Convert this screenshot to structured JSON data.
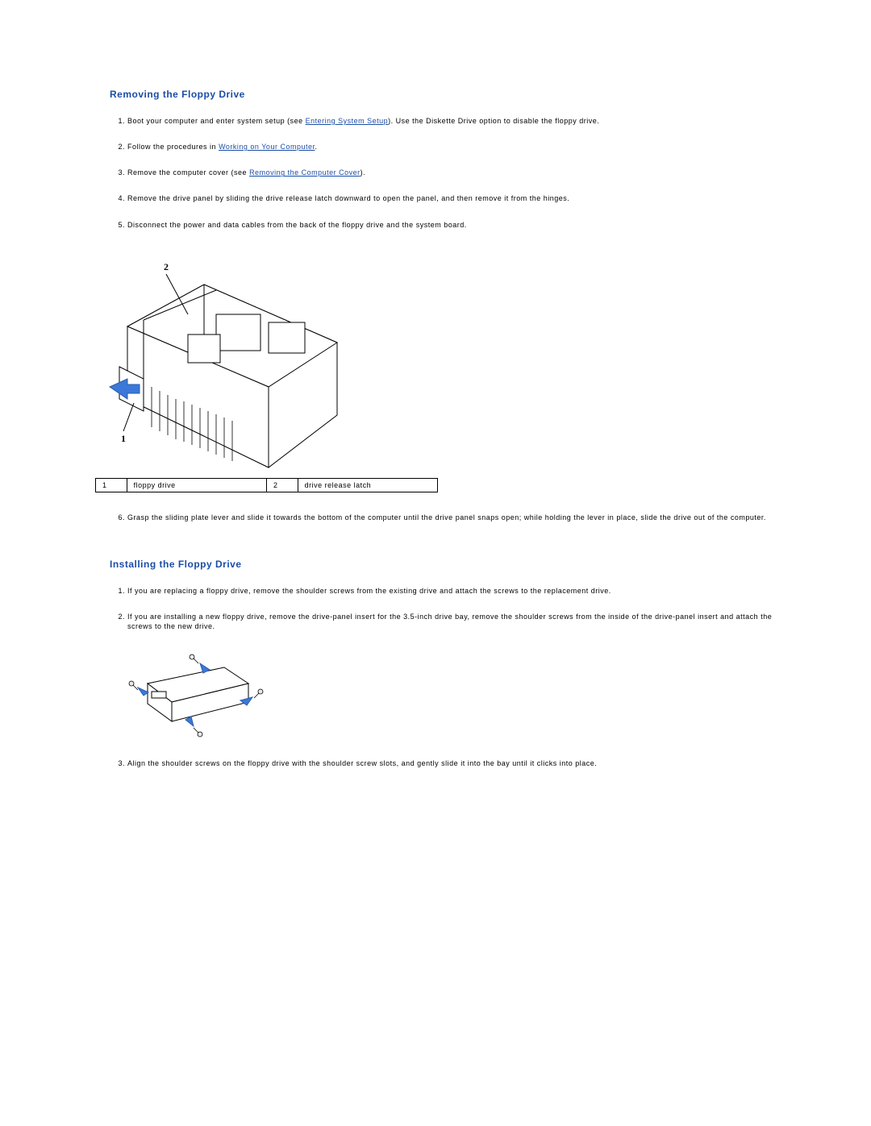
{
  "sections": {
    "removing": {
      "heading": "Removing the Floppy Drive",
      "steps": {
        "s1": {
          "pre": "Boot your computer and enter system setup (see ",
          "link": "Entering System Setup",
          "post": "). Use the Diskette Drive option to disable the floppy drive."
        },
        "s2": {
          "pre": "Follow the procedures in ",
          "link": "Working on Your Computer",
          "post": "."
        },
        "s3": {
          "pre": "Remove the computer cover (see ",
          "link": "Removing the Computer Cover",
          "post": ")."
        },
        "s4": "Remove the drive panel by sliding the drive release latch downward to open the panel, and then remove it from the hinges.",
        "s5": "Disconnect the power and data cables from the back of the floppy drive and the system board.",
        "s6": "Grasp the sliding plate lever and slide it towards the bottom of the computer until the drive panel snaps open; while holding the lever in place, slide the drive out of the computer."
      },
      "legend": {
        "n1": "1",
        "l1": "floppy drive",
        "n2": "2",
        "l2": "drive release latch"
      }
    },
    "installing": {
      "heading": "Installing the Floppy Drive",
      "steps": {
        "s1": "If you are replacing a floppy drive, remove the shoulder screws from the existing drive and attach the screws to the replacement drive.",
        "s2": "If you are installing a new floppy drive, remove the drive-panel insert for the 3.5-inch drive bay, remove the shoulder screws from the inside of the drive-panel insert and attach the screws to the new drive.",
        "s3": "Align the shoulder screws on the floppy drive with the shoulder screw slots, and gently slide it into the bay until it clicks into place."
      }
    }
  },
  "callouts": {
    "c1": "1",
    "c2": "2"
  }
}
